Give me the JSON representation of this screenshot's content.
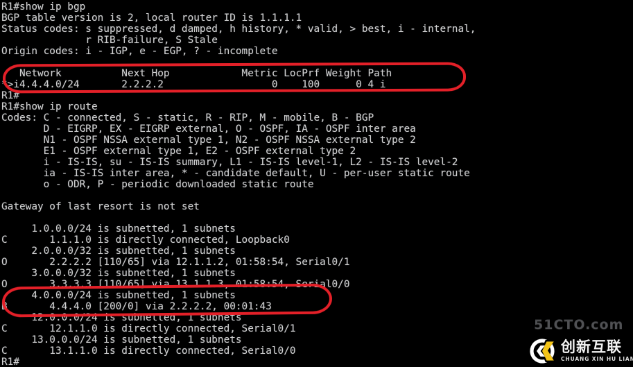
{
  "terminal": {
    "prompt": "R1#",
    "colors": {
      "background": "#000000",
      "text": "#cfcfcf",
      "annotation": "#e32028",
      "logo_accent": "#f5c518"
    },
    "lines": [
      "R1#show ip bgp",
      "BGP table version is 2, local router ID is 1.1.1.1",
      "Status codes: s suppressed, d damped, h history, * valid, > best, i - internal,",
      "              r RIB-failure, S Stale",
      "Origin codes: i - IGP, e - EGP, ? - incomplete",
      "",
      "   Network          Next Hop            Metric LocPrf Weight Path",
      "*>i4.4.4.0/24       2.2.2.2                  0    100      0 4 i",
      "R1#",
      "R1#show ip route",
      "Codes: C - connected, S - static, R - RIP, M - mobile, B - BGP",
      "       D - EIGRP, EX - EIGRP external, O - OSPF, IA - OSPF inter area",
      "       N1 - OSPF NSSA external type 1, N2 - OSPF NSSA external type 2",
      "       E1 - OSPF external type 1, E2 - OSPF external type 2",
      "       i - IS-IS, su - IS-IS summary, L1 - IS-IS level-1, L2 - IS-IS level-2",
      "       ia - IS-IS inter area, * - candidate default, U - per-user static route",
      "       o - ODR, P - periodic downloaded static route",
      "",
      "Gateway of last resort is not set",
      "",
      "     1.0.0.0/24 is subnetted, 1 subnets",
      "C       1.1.1.0 is directly connected, Loopback0",
      "     2.0.0.0/32 is subnetted, 1 subnets",
      "O       2.2.2.2 [110/65] via 12.1.1.2, 01:58:54, Serial0/1",
      "     3.0.0.0/32 is subnetted, 1 subnets",
      "O       3.3.3.3 [110/65] via 13.1.1.3, 01:58:54, Serial0/0",
      "     4.0.0.0/24 is subnetted, 1 subnets",
      "B       4.4.4.0 [200/0] via 2.2.2.2, 00:01:43",
      "     12.0.0.0/24 is subnetted, 1 subnets",
      "C       12.1.1.0 is directly connected, Serial0/1",
      "     13.0.0.0/24 is subnetted, 1 subnets",
      "C       13.1.1.0 is directly connected, Serial0/0",
      "R1#"
    ]
  },
  "bgp_table": {
    "headers": [
      "Network",
      "Next Hop",
      "Metric",
      "LocPrf",
      "Weight",
      "Path"
    ],
    "rows": [
      {
        "status": "*>i",
        "network": "4.4.4.0/24",
        "next_hop": "2.2.2.2",
        "metric": "0",
        "locprf": "100",
        "weight": "0",
        "path": "4 i"
      }
    ],
    "table_version": "2",
    "local_router_id": "1.1.1.1"
  },
  "route_table": {
    "gateway_of_last_resort": "not set",
    "entries": [
      {
        "code": "",
        "network": "1.0.0.0/24",
        "detail": "is subnetted, 1 subnets"
      },
      {
        "code": "C",
        "network": "1.1.1.0",
        "detail": "is directly connected, Loopback0"
      },
      {
        "code": "",
        "network": "2.0.0.0/32",
        "detail": "is subnetted, 1 subnets"
      },
      {
        "code": "O",
        "network": "2.2.2.2",
        "detail": "[110/65] via 12.1.1.2, 01:58:54, Serial0/1"
      },
      {
        "code": "",
        "network": "3.0.0.0/32",
        "detail": "is subnetted, 1 subnets"
      },
      {
        "code": "O",
        "network": "3.3.3.3",
        "detail": "[110/65] via 13.1.1.3, 01:58:54, Serial0/0"
      },
      {
        "code": "",
        "network": "4.0.0.0/24",
        "detail": "is subnetted, 1 subnets"
      },
      {
        "code": "B",
        "network": "4.4.4.0",
        "detail": "[200/0] via 2.2.2.2, 00:01:43"
      },
      {
        "code": "",
        "network": "12.0.0.0/24",
        "detail": "is subnetted, 1 subnets"
      },
      {
        "code": "C",
        "network": "12.1.1.0",
        "detail": "is directly connected, Serial0/1"
      },
      {
        "code": "",
        "network": "13.0.0.0/24",
        "detail": "is subnetted, 1 subnets"
      },
      {
        "code": "C",
        "network": "13.1.1.0",
        "detail": "is directly connected, Serial0/0"
      }
    ]
  },
  "annotations": [
    {
      "name": "bgp-entry-highlight",
      "shape": "oval",
      "color": "#e32028"
    },
    {
      "name": "bgp-route-highlight",
      "shape": "oval",
      "color": "#e32028"
    }
  ],
  "watermark": {
    "site": "51CTO.com"
  },
  "logo": {
    "name_cn": "创新互联",
    "name_pinyin": "CHUANG XIN HU LIAN",
    "mark_letters": "CX"
  }
}
